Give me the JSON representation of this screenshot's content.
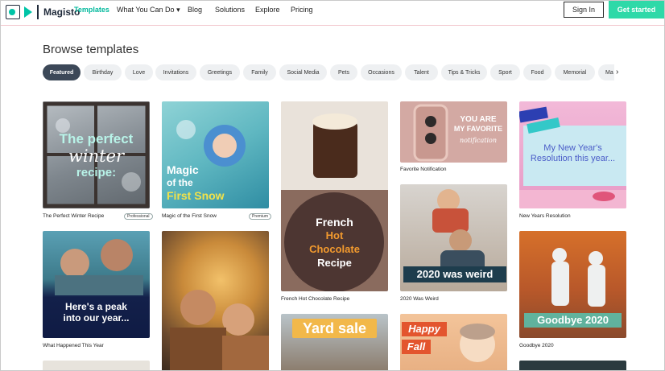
{
  "nav": {
    "logo_text": "Magisto",
    "links": [
      "Templates",
      "What You Can Do",
      "Blog",
      "Solutions",
      "Explore",
      "Pricing"
    ],
    "caret": "▾",
    "signin": "Sign In",
    "get_started": "Get started"
  },
  "page": {
    "heading": "Browse templates"
  },
  "chips": [
    "Featured",
    "Birthday",
    "Love",
    "Invitations",
    "Greetings",
    "Family",
    "Social Media",
    "Pets",
    "Occasions",
    "Talent",
    "Tips & Tricks",
    "Sport",
    "Food",
    "Memorial",
    "Ma"
  ],
  "chip_arrow": "›",
  "cards": {
    "winter": {
      "caption": "The Perfect Winter Recipe",
      "badge": "Professional",
      "line1": "The perfect",
      "line2": "winter",
      "line3": "recipe:"
    },
    "snow": {
      "caption": "Magic of the First Snow",
      "badge": "Premium",
      "line1": "Magic",
      "line2": "of the",
      "line3": "First Snow"
    },
    "choc": {
      "caption": "French Hot Chocolate Recipe",
      "line1": "French",
      "line2": "Hot",
      "line3": "Chocolate",
      "line4": "Recipe"
    },
    "notif": {
      "caption": "Favorite Notification",
      "line1": "YOU ARE",
      "line2": "MY FAVORITE",
      "line3": "notification"
    },
    "resolution": {
      "caption": "New Years Resolution",
      "line1": "My New Year's",
      "line2": "Resolution this year..."
    },
    "weird": {
      "caption": "2020 Was Weird",
      "text": "2020 was weird"
    },
    "peak": {
      "caption": "What Happened This Year",
      "line1": "Here's a peak",
      "line2": "into our year..."
    },
    "goodbye": {
      "caption": "Goodbye 2020",
      "text": "Goodbye 2020"
    },
    "yard": {
      "text": "Yard sale"
    },
    "fall": {
      "line1": "Happy",
      "line2": "Fall"
    }
  },
  "colors": {
    "accent": "#00b89c",
    "cta": "#2ed9a8",
    "chip_active": "#3c4858"
  }
}
